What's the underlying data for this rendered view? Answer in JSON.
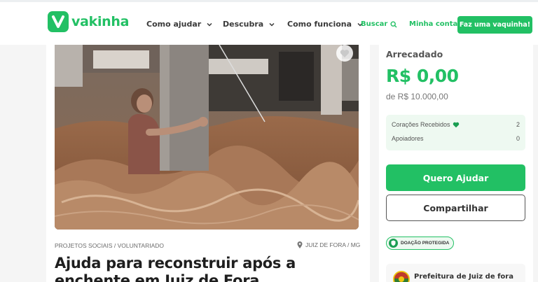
{
  "brand": {
    "name": "vakinha",
    "color": "#22c064"
  },
  "nav": {
    "items": [
      {
        "label": "Como ajudar",
        "icon": "chevron-down-icon"
      },
      {
        "label": "Descubra",
        "icon": "chevron-down-icon"
      },
      {
        "label": "Como funciona",
        "icon": "chevron-down-icon"
      }
    ],
    "search_label": "Buscar",
    "account_label": "Minha conta",
    "cta_label": "Faz uma vaquinha!"
  },
  "campaign": {
    "image_alt_icon": "flood-photo",
    "favorite_icon": "heart-icon",
    "category": "PROJETOS SOCIAIS / VOLUNTARIADO",
    "location": "JUIZ DE FORA / MG",
    "title": "Ajuda para reconstruir após a enchente em Juiz de Fora"
  },
  "donation": {
    "raised_label": "Arrecadado",
    "raised_value": "R$ 0,00",
    "goal": "de R$ 10.000,00",
    "stats": [
      {
        "label": "Corações Recebidos",
        "icon": "heart-icon",
        "value": "2"
      },
      {
        "label": "Apoiadores",
        "value": "0"
      }
    ],
    "primary_button": "Quero Ajudar",
    "secondary_button": "Compartilhar",
    "protected_badge": "DOAÇÃO PROTEGIDA"
  },
  "organizer": {
    "name": "Prefeitura de Juiz de fora"
  }
}
